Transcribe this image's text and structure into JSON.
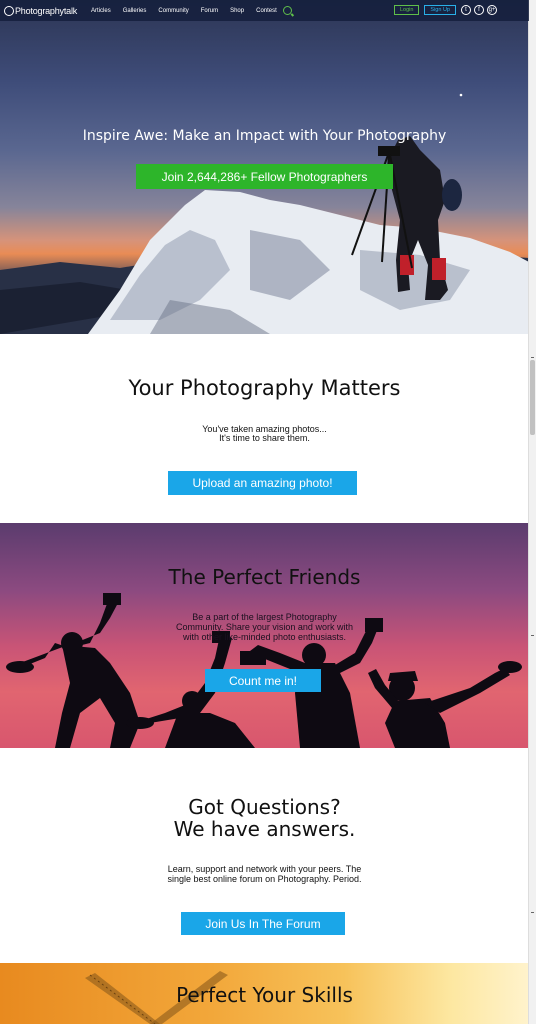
{
  "nav": {
    "logo": "Photographytalk",
    "links": [
      "Articles",
      "Galleries",
      "Community",
      "Forum",
      "Shop",
      "Contest"
    ],
    "login": "Login",
    "signup": "Sign Up",
    "social": [
      "twitter-icon",
      "facebook-icon",
      "google-plus-icon"
    ]
  },
  "hero": {
    "title": "Inspire Awe: Make an Impact with Your Photography",
    "cta": "Join 2,644,286+ Fellow Photographers"
  },
  "matters": {
    "title": "Your Photography Matters",
    "line1": "You've taken amazing photos...",
    "line2": "It's time to share them.",
    "cta": "Upload an amazing photo!"
  },
  "friends": {
    "title": "The Perfect Friends",
    "line1": "Be a part of the largest Photography",
    "line2": "Community. Share your vision and work with",
    "line3": "with other like-minded photo enthusiasts.",
    "cta": "Count me in!"
  },
  "questions": {
    "title1": "Got Questions?",
    "title2": "We have answers.",
    "line1": "Learn, support and network with your peers. The",
    "line2": "single best online forum on Photography. Period.",
    "cta": "Join Us In The Forum"
  },
  "skills": {
    "title": "Perfect Your Skills"
  },
  "colors": {
    "green": "#2db52a",
    "blue": "#1aa6e8"
  }
}
